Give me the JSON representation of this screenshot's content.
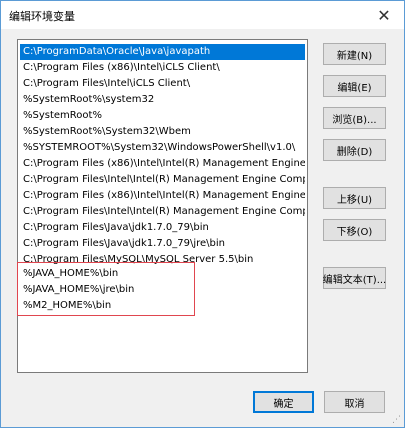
{
  "window": {
    "title": "编辑环境变量",
    "close_label": "✕"
  },
  "path_list": {
    "selected_index": 0,
    "items": [
      "C:\\ProgramData\\Oracle\\Java\\javapath",
      "C:\\Program Files (x86)\\Intel\\iCLS Client\\",
      "C:\\Program Files\\Intel\\iCLS Client\\",
      "%SystemRoot%\\system32",
      "%SystemRoot%",
      "%SystemRoot%\\System32\\Wbem",
      "%SYSTEMROOT%\\System32\\WindowsPowerShell\\v1.0\\",
      "C:\\Program Files (x86)\\Intel\\Intel(R) Management Engine Comp...",
      "C:\\Program Files\\Intel\\Intel(R) Management Engine Component...",
      "C:\\Program Files (x86)\\Intel\\Intel(R) Management Engine Comp...",
      "C:\\Program Files\\Intel\\Intel(R) Management Engine Component...",
      "C:\\Program Files\\Java\\jdk1.7.0_79\\bin",
      "C:\\Program Files\\Java\\jdk1.7.0_79\\jre\\bin",
      "C:\\Program Files\\MySQL\\MySQL Server 5.5\\bin",
      "%JAVA_HOME%\\bin",
      "%JAVA_HOME%\\jre\\bin",
      "%M2_HOME%\\bin"
    ]
  },
  "buttons": {
    "new": "新建(N)",
    "edit": "编辑(E)",
    "browse": "浏览(B)...",
    "delete": "删除(D)",
    "move_up": "上移(U)",
    "move_down": "下移(O)",
    "edit_text": "编辑文本(T)...",
    "ok": "确定",
    "cancel": "取消"
  },
  "colors": {
    "selection": "#0078d7",
    "highlight_box": "#e0464f"
  }
}
